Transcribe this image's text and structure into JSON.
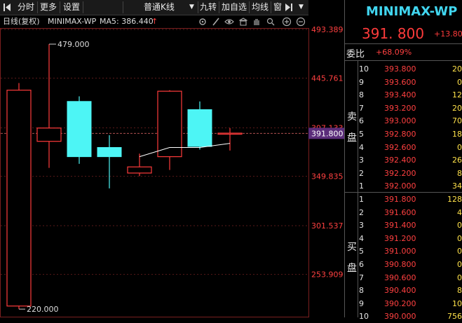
{
  "toolbar": {
    "items": [
      "分时",
      "更多",
      "设置"
    ],
    "kline_type": "普通K线",
    "buttons": [
      "九转",
      "加自选",
      "均线",
      "窗"
    ]
  },
  "chart_info": {
    "period": "日线(复权)",
    "symbol": "MINIMAX-WP",
    "ma_label": "MA5: 386.440",
    "ma_arrow": "↑"
  },
  "price_axis": {
    "labels": [
      "493.389",
      "445.761",
      "397.133",
      "349.835",
      "301.537",
      "253.909"
    ],
    "current_price_tag": "391.800"
  },
  "annotations": {
    "high": "479.000",
    "low": "220.000"
  },
  "candles": [
    {
      "open": 434,
      "close": 223,
      "high": 441,
      "low": 220,
      "color": "red"
    },
    {
      "open": 397,
      "close": 384,
      "high": 479,
      "low": 358,
      "color": "red"
    },
    {
      "open": 423,
      "close": 369,
      "high": 428,
      "low": 362,
      "color": "cyan"
    },
    {
      "open": 378,
      "close": 369,
      "high": 390,
      "low": 338,
      "color": "cyan"
    },
    {
      "open": 353,
      "close": 359,
      "high": 372,
      "low": 350,
      "color": "red"
    },
    {
      "open": 369,
      "close": 433,
      "high": 434,
      "low": 356,
      "color": "red"
    },
    {
      "open": 415,
      "close": 379,
      "high": 423,
      "low": 376,
      "color": "cyan"
    },
    {
      "open": 391,
      "close": 392,
      "high": 397,
      "low": 375,
      "color": "red"
    }
  ],
  "ma5": [
    null,
    null,
    null,
    null,
    369,
    378,
    378,
    382
  ],
  "quote": {
    "name": "MINIMAX-WP",
    "price": "391. 800",
    "change": "+13.80",
    "webi_label": "委比",
    "webi_value": "+68.09%",
    "sell_label": [
      "卖",
      "盘"
    ],
    "buy_label": [
      "买",
      "盘"
    ]
  },
  "order_book": {
    "asks": [
      {
        "level": "10",
        "price": "393.800",
        "vol": "20"
      },
      {
        "level": "9",
        "price": "393.600",
        "vol": "0"
      },
      {
        "level": "8",
        "price": "393.400",
        "vol": "12"
      },
      {
        "level": "7",
        "price": "393.200",
        "vol": "20"
      },
      {
        "level": "6",
        "price": "393.000",
        "vol": "70"
      },
      {
        "level": "5",
        "price": "392.800",
        "vol": "18"
      },
      {
        "level": "4",
        "price": "392.600",
        "vol": "0"
      },
      {
        "level": "3",
        "price": "392.400",
        "vol": "26"
      },
      {
        "level": "2",
        "price": "392.200",
        "vol": "8"
      },
      {
        "level": "1",
        "price": "392.000",
        "vol": "34"
      }
    ],
    "bids": [
      {
        "level": "1",
        "price": "391.800",
        "vol": "128"
      },
      {
        "level": "2",
        "price": "391.600",
        "vol": "4"
      },
      {
        "level": "3",
        "price": "391.400",
        "vol": "0"
      },
      {
        "level": "4",
        "price": "391.200",
        "vol": "0"
      },
      {
        "level": "5",
        "price": "391.000",
        "vol": "0"
      },
      {
        "level": "6",
        "price": "390.800",
        "vol": "0"
      },
      {
        "level": "7",
        "price": "390.600",
        "vol": "0"
      },
      {
        "level": "8",
        "price": "390.400",
        "vol": "8"
      },
      {
        "level": "9",
        "price": "390.200",
        "vol": "10"
      },
      {
        "level": "10",
        "price": "390.000",
        "vol": "756"
      }
    ]
  },
  "colors": {
    "up": "#ff3b3b",
    "down": "#4df5f5",
    "title": "#41d6f0",
    "vol": "#ffe24a"
  }
}
